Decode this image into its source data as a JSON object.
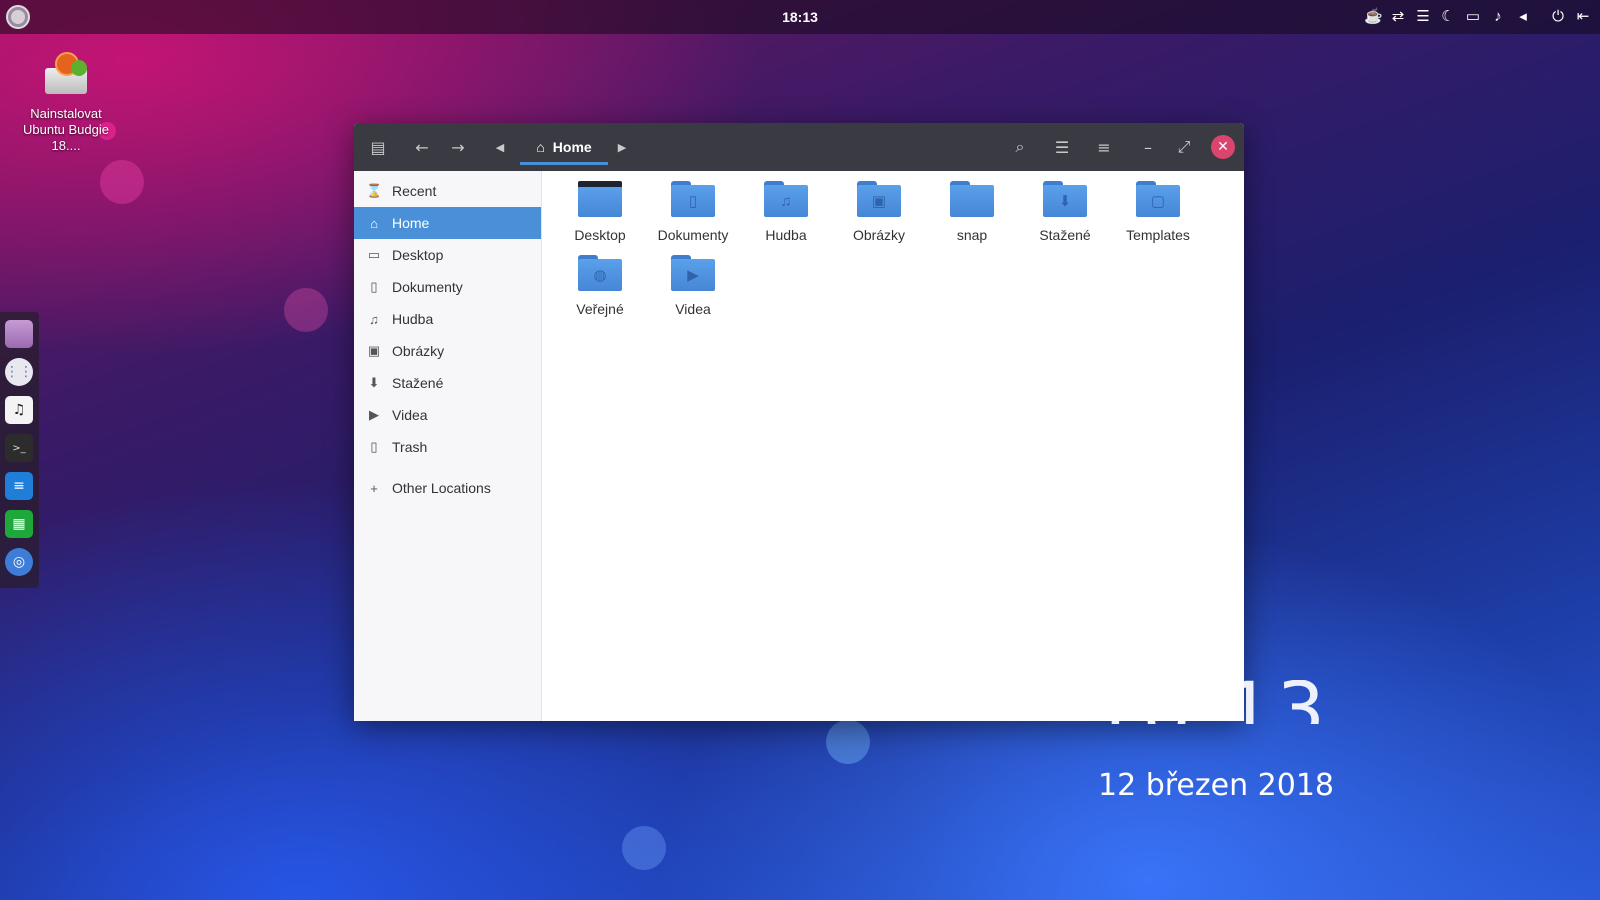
{
  "top_panel": {
    "time": "18:13",
    "tray_icons": [
      "coffee-icon",
      "transfer-icon",
      "menu-lines-icon",
      "moon-icon",
      "folder-icon",
      "bell-icon",
      "volume-icon",
      "power-icon",
      "exit-icon"
    ]
  },
  "desktop": {
    "icon_label": "Nainstalovat Ubuntu Budgie 18...."
  },
  "dock": {
    "items": [
      "files-icon",
      "app-grid-icon",
      "music-icon",
      "terminal-icon",
      "writer-icon",
      "calc-icon",
      "chrome-icon"
    ]
  },
  "window": {
    "path_label": "Home",
    "sidebar": {
      "items": [
        {
          "label": "Recent",
          "icon": "recent-icon",
          "glyph": "⌛"
        },
        {
          "label": "Home",
          "icon": "home-icon",
          "glyph": "⌂"
        },
        {
          "label": "Desktop",
          "icon": "desktop-icon",
          "glyph": "▭"
        },
        {
          "label": "Dokumenty",
          "icon": "document-icon",
          "glyph": "▯"
        },
        {
          "label": "Hudba",
          "icon": "music-icon",
          "glyph": "♫"
        },
        {
          "label": "Obrázky",
          "icon": "pictures-icon",
          "glyph": "▣"
        },
        {
          "label": "Stažené",
          "icon": "download-icon",
          "glyph": "⬇"
        },
        {
          "label": "Videa",
          "icon": "video-icon",
          "glyph": "▶"
        },
        {
          "label": "Trash",
          "icon": "trash-icon",
          "glyph": "▯"
        }
      ],
      "other_locations": "Other Locations"
    },
    "files": [
      {
        "label": "Desktop",
        "glyph": ""
      },
      {
        "label": "Dokumenty",
        "glyph": "▯"
      },
      {
        "label": "Hudba",
        "glyph": "♫"
      },
      {
        "label": "Obrázky",
        "glyph": "▣"
      },
      {
        "label": "snap",
        "glyph": ""
      },
      {
        "label": "Stažené",
        "glyph": "⬇"
      },
      {
        "label": "Templates",
        "glyph": "▢"
      },
      {
        "label": "Veřejné",
        "glyph": "◍"
      },
      {
        "label": "Videa",
        "glyph": "▶"
      }
    ]
  },
  "clock_widget": {
    "time": "18:13",
    "date": "12 březen 2018"
  }
}
